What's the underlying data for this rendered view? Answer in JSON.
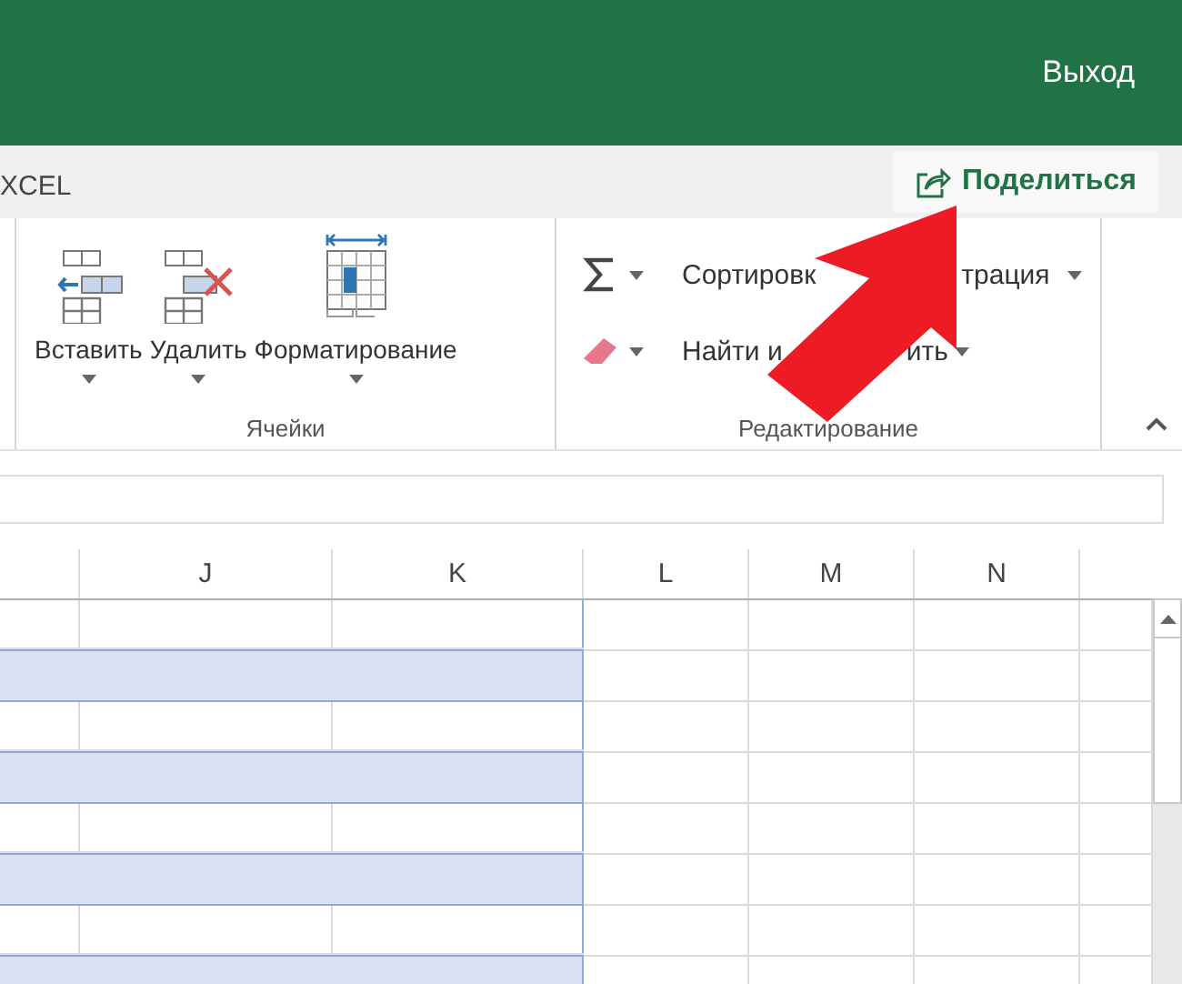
{
  "header": {
    "sign_out": "Выход"
  },
  "tab_bar": {
    "app_name": "XCEL",
    "share_button": "Поделиться"
  },
  "cells_group": {
    "label": "Ячейки",
    "commands": [
      {
        "label": "Вставить",
        "kind": "insert"
      },
      {
        "label": "Удалить",
        "kind": "delete"
      },
      {
        "label": "Форматирование",
        "kind": "format"
      }
    ]
  },
  "editing_group": {
    "label": "Редактирование",
    "rows": [
      {
        "kind": "sum",
        "text_parts": [
          "Сортировк",
          "трация"
        ]
      },
      {
        "kind": "clear",
        "text_parts": [
          "Найти и",
          "ить"
        ]
      }
    ]
  },
  "columns": [
    "J",
    "K",
    "L",
    "M",
    "N"
  ],
  "rows": [
    {
      "kind": "plain"
    },
    {
      "kind": "band"
    },
    {
      "kind": "plain"
    },
    {
      "kind": "band"
    },
    {
      "kind": "plain"
    },
    {
      "kind": "band"
    },
    {
      "kind": "plain"
    },
    {
      "kind": "band"
    }
  ]
}
